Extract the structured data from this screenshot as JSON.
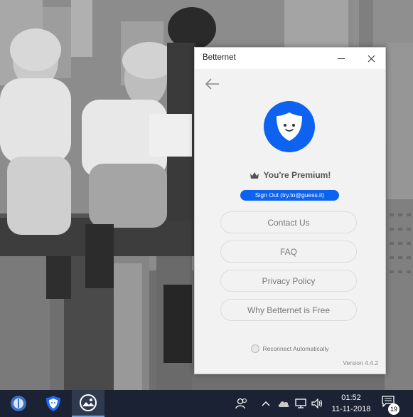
{
  "window": {
    "title": "Betternet",
    "premium_text": "You're Premium!",
    "signout_label": "Sign Out (try.to@guess.it)",
    "menu": [
      {
        "label": "Contact Us"
      },
      {
        "label": "FAQ"
      },
      {
        "label": "Privacy Policy"
      },
      {
        "label": "Why Betternet is Free"
      }
    ],
    "reconnect_label": "Reconnect Automatically",
    "version": "Version 4.4.2"
  },
  "taskbar": {
    "time": "01:52",
    "date": "11-11-2018",
    "notification_count": "19"
  },
  "colors": {
    "accent": "#0d63f0",
    "taskbar": "#1a2233"
  },
  "icons": [
    "back-arrow-icon",
    "shield-face-icon",
    "crown-icon",
    "minimize-icon",
    "close-icon",
    "people-icon",
    "chevron-up-icon",
    "cloud-icon",
    "network-icon",
    "volume-icon",
    "notification-icon"
  ]
}
